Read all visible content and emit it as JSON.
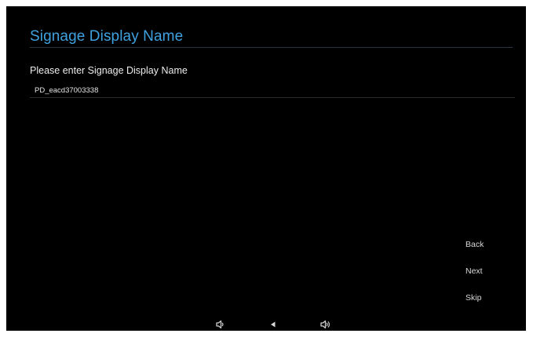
{
  "screen": {
    "title": "Signage Display Name",
    "prompt": "Please enter Signage Display Name",
    "name_field": {
      "value": "PD_eacd37003338"
    }
  },
  "actions": {
    "back": "Back",
    "next": "Next",
    "skip": "Skip"
  },
  "navbar": {
    "icons": [
      "volume-down-icon",
      "back-triangle-icon",
      "volume-up-icon"
    ]
  },
  "colors": {
    "background": "#000000",
    "title": "#3fa1e0",
    "text": "#ececec"
  }
}
